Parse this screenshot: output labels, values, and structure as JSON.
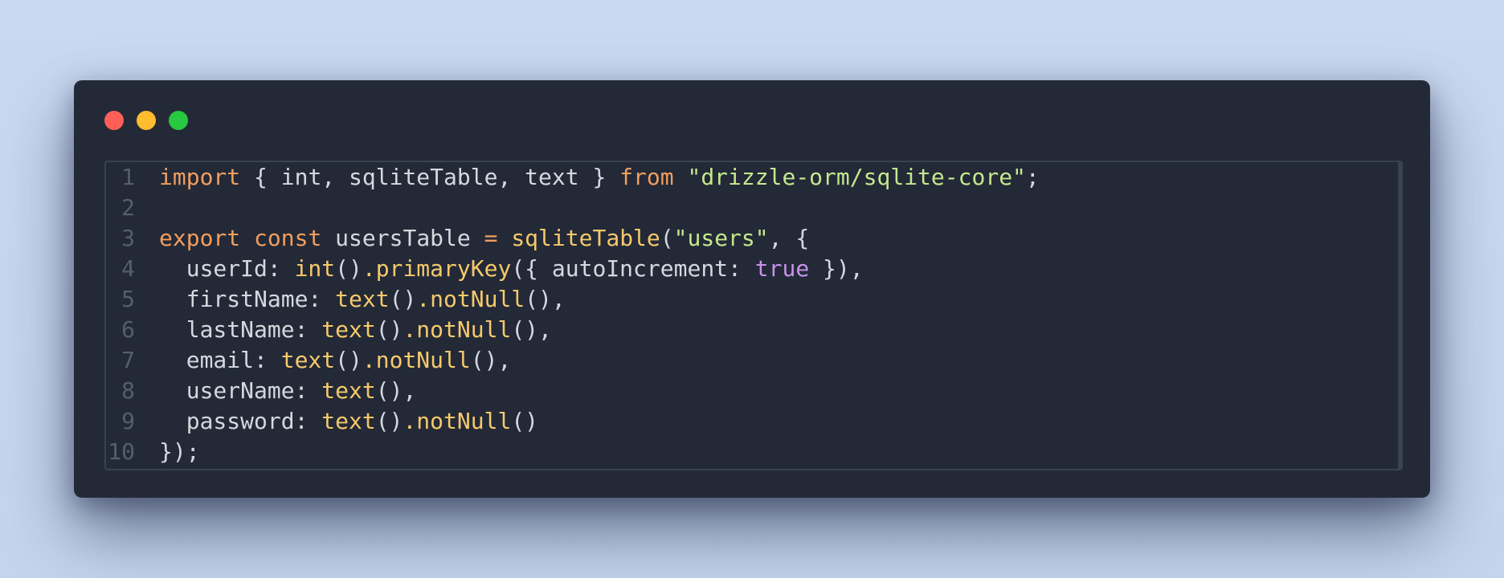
{
  "window": {
    "controls": [
      "close",
      "minimize",
      "maximize"
    ],
    "colors": {
      "close": "#ff5f57",
      "minimize": "#febc2e",
      "maximize": "#28c840",
      "background": "#232937"
    }
  },
  "code": {
    "language": "typescript",
    "lines": [
      {
        "number": "1",
        "tokens": [
          {
            "t": "import",
            "c": "k"
          },
          {
            "t": " { int, sqliteTable, text } ",
            "c": "p"
          },
          {
            "t": "from",
            "c": "k"
          },
          {
            "t": " ",
            "c": "p"
          },
          {
            "t": "\"drizzle-orm/sqlite-core\"",
            "c": "s"
          },
          {
            "t": ";",
            "c": "p"
          }
        ]
      },
      {
        "number": "2",
        "tokens": []
      },
      {
        "number": "3",
        "tokens": [
          {
            "t": "export",
            "c": "k"
          },
          {
            "t": " ",
            "c": "p"
          },
          {
            "t": "const",
            "c": "k"
          },
          {
            "t": " usersTable ",
            "c": "p"
          },
          {
            "t": "=",
            "c": "k"
          },
          {
            "t": " ",
            "c": "p"
          },
          {
            "t": "sqliteTable",
            "c": "f"
          },
          {
            "t": "(",
            "c": "p"
          },
          {
            "t": "\"users\"",
            "c": "s"
          },
          {
            "t": ", {",
            "c": "p"
          }
        ]
      },
      {
        "number": "4",
        "tokens": [
          {
            "t": "  userId: ",
            "c": "p"
          },
          {
            "t": "int",
            "c": "f"
          },
          {
            "t": "()",
            "c": "p"
          },
          {
            "t": ".primaryKey",
            "c": "f"
          },
          {
            "t": "({ autoIncrement: ",
            "c": "p"
          },
          {
            "t": "true",
            "c": "b"
          },
          {
            "t": " }),",
            "c": "p"
          }
        ]
      },
      {
        "number": "5",
        "tokens": [
          {
            "t": "  firstName: ",
            "c": "p"
          },
          {
            "t": "text",
            "c": "f"
          },
          {
            "t": "()",
            "c": "p"
          },
          {
            "t": ".notNull",
            "c": "f"
          },
          {
            "t": "(),",
            "c": "p"
          }
        ]
      },
      {
        "number": "6",
        "tokens": [
          {
            "t": "  lastName: ",
            "c": "p"
          },
          {
            "t": "text",
            "c": "f"
          },
          {
            "t": "()",
            "c": "p"
          },
          {
            "t": ".notNull",
            "c": "f"
          },
          {
            "t": "(),",
            "c": "p"
          }
        ]
      },
      {
        "number": "7",
        "tokens": [
          {
            "t": "  email: ",
            "c": "p"
          },
          {
            "t": "text",
            "c": "f"
          },
          {
            "t": "()",
            "c": "p"
          },
          {
            "t": ".notNull",
            "c": "f"
          },
          {
            "t": "(),",
            "c": "p"
          }
        ]
      },
      {
        "number": "8",
        "tokens": [
          {
            "t": "  userName: ",
            "c": "p"
          },
          {
            "t": "text",
            "c": "f"
          },
          {
            "t": "(),",
            "c": "p"
          }
        ]
      },
      {
        "number": "9",
        "tokens": [
          {
            "t": "  password: ",
            "c": "p"
          },
          {
            "t": "text",
            "c": "f"
          },
          {
            "t": "()",
            "c": "p"
          },
          {
            "t": ".notNull",
            "c": "f"
          },
          {
            "t": "()",
            "c": "p"
          }
        ]
      },
      {
        "number": "10",
        "tokens": [
          {
            "t": "});",
            "c": "p"
          }
        ]
      }
    ]
  }
}
